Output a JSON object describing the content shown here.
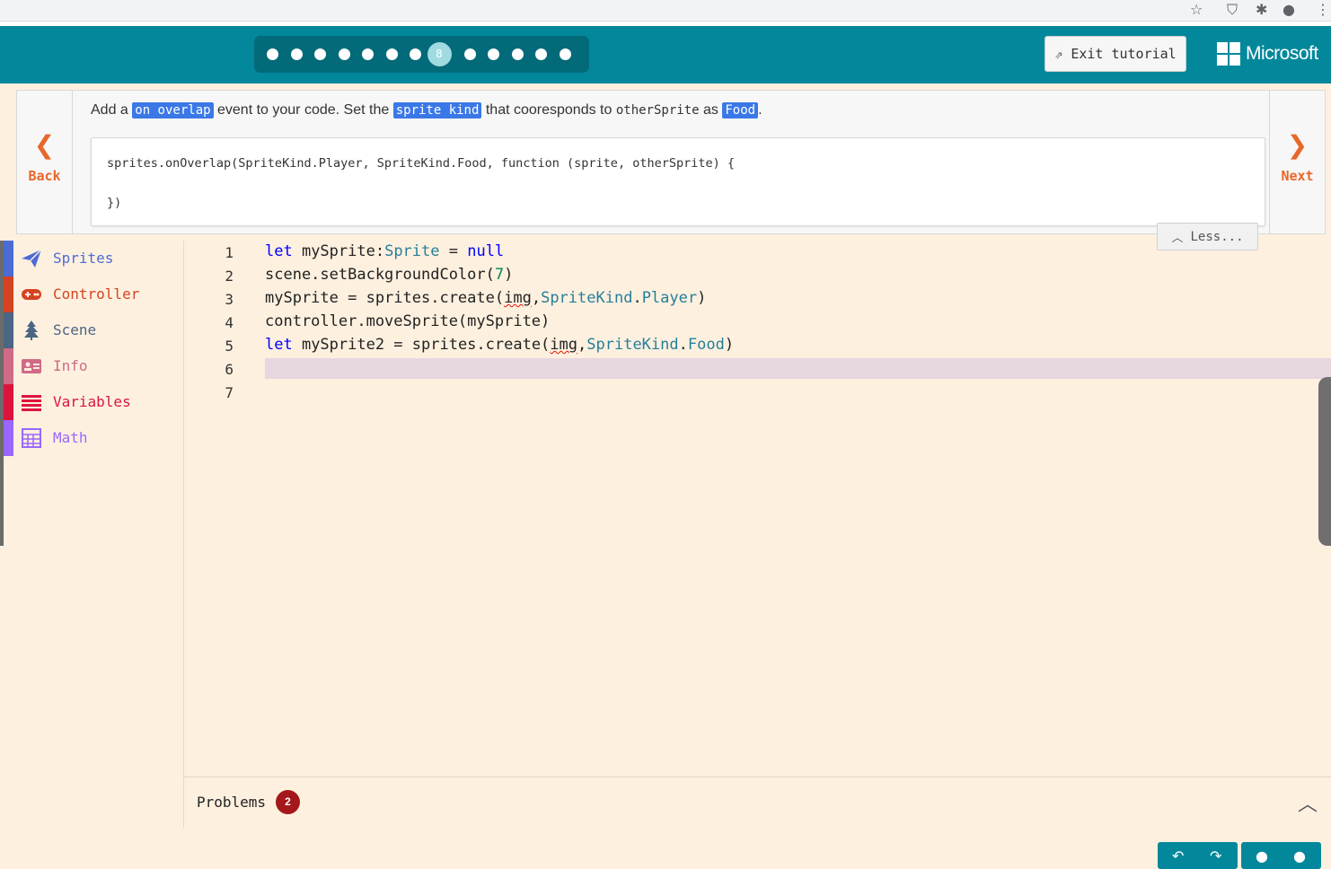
{
  "browser": {
    "icons": [
      "star-icon",
      "shield-extension-icon",
      "puzzle-extension-icon",
      "profile-icon",
      "kebab-menu-icon"
    ]
  },
  "header": {
    "progress": {
      "total_steps": 13,
      "current_step": 8,
      "current_label": "8"
    },
    "exit_label": "Exit tutorial",
    "brand": "Microsoft"
  },
  "tutorial": {
    "back_label": "Back",
    "next_label": "Next",
    "instruction": {
      "t1": "Add a ",
      "h1": "on overlap",
      "t2": " event to your code. Set the ",
      "h2": "sprite kind",
      "t3": " that cooresponds to ",
      "m1": "otherSprite",
      "t4": " as ",
      "h3": "Food",
      "t5": "."
    },
    "hint_code": "sprites.onOverlap(SpriteKind.Player, SpriteKind.Food, function (sprite, otherSprite) {\n\n})",
    "less_label": "Less..."
  },
  "toolbox": {
    "items": [
      {
        "label": "Sprites",
        "color": "#4b6cd4",
        "icon": "paper-plane-icon"
      },
      {
        "label": "Controller",
        "color": "#d54322",
        "icon": "gamepad-icon"
      },
      {
        "label": "Scene",
        "color": "#4b6584",
        "icon": "tree-icon"
      },
      {
        "label": "Info",
        "color": "#cf6a87",
        "icon": "id-card-icon"
      },
      {
        "label": "Variables",
        "color": "#dc143c",
        "icon": "list-icon"
      },
      {
        "label": "Math",
        "color": "#9966ff",
        "icon": "calculator-icon"
      }
    ]
  },
  "editor": {
    "line_numbers": [
      "1",
      "2",
      "3",
      "4",
      "5",
      "6",
      "7"
    ],
    "active_line": 6,
    "lines": {
      "l1": {
        "kw1": "let",
        "t1": " mySprite:",
        "ty1": "Sprite",
        "t2": " = ",
        "kw2": "null"
      },
      "l2": {
        "t1": "scene.setBackgroundColor(",
        "n1": "7",
        "t2": ")"
      },
      "l3": {
        "t1": "mySprite = sprites.create(",
        "sq": "img",
        "t2": ",",
        "ty1": "SpriteKind",
        "t3": ".",
        "ty2": "Player",
        "t4": ")"
      },
      "l4": {
        "t1": "controller.moveSprite(mySprite)"
      },
      "l5": {
        "kw1": "let",
        "t1": " mySprite2 = sprites.create(",
        "sq": "img",
        "t2": ",",
        "ty1": "SpriteKind",
        "t3": ".",
        "ty2": "Food",
        "t4": ")"
      }
    }
  },
  "problems": {
    "label": "Problems",
    "count": "2"
  },
  "colors": {
    "header": "#03879b",
    "accent": "#e8672a",
    "highlight": "#3b78e7",
    "editor_bg": "#fdf0df"
  }
}
